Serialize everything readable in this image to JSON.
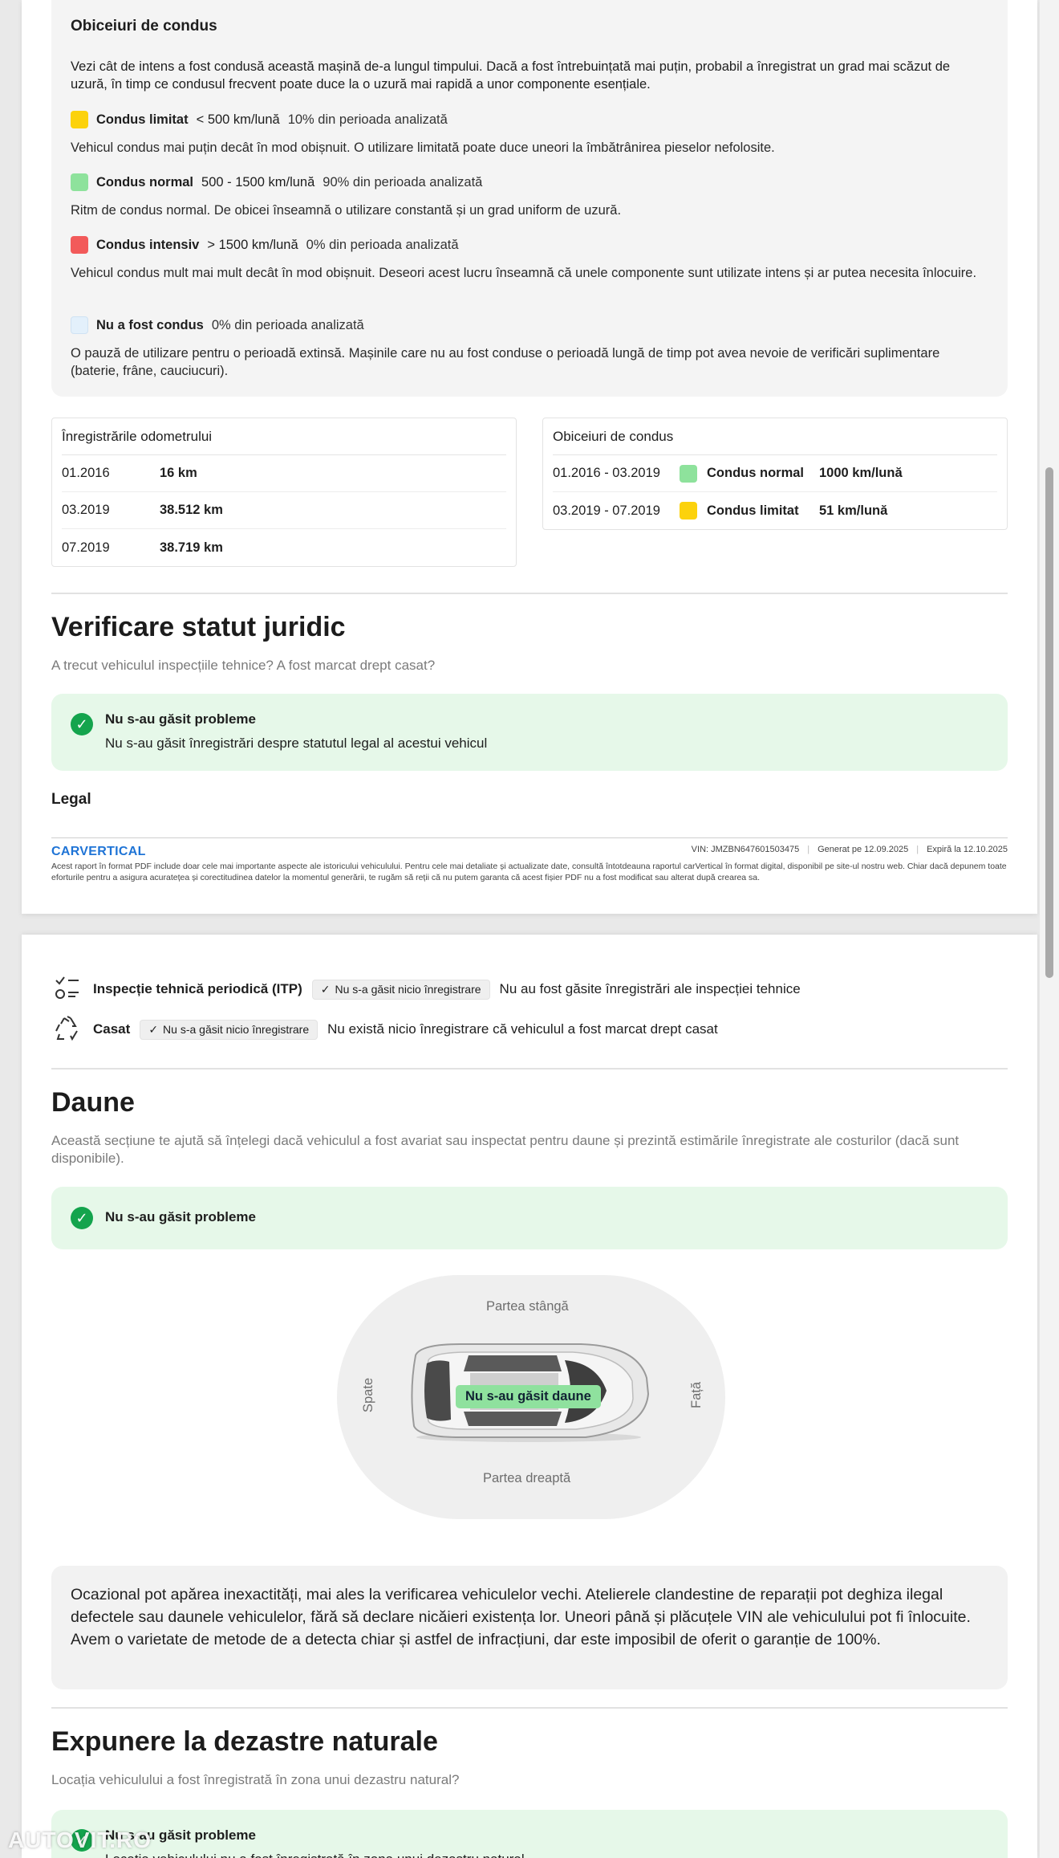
{
  "driving_habits": {
    "title": "Obiceiuri de condus",
    "description": "Vezi cât de intens a fost condusă această mașină de-a lungul timpului. Dacă a fost întrebuințată mai puțin, probabil a înregistrat un grad mai scăzut de uzură, în timp ce condusul frecvent poate duce la o uzură mai rapidă a unor componente esențiale.",
    "items": [
      {
        "name": "Condus limitat",
        "range": "< 500 km/lună",
        "percent": "10% din perioada analizată",
        "text": "Vehicul condus mai puțin decât în mod obișnuit. O utilizare limitată poate duce uneori la îmbătrânirea pieselor nefolosite.",
        "color": "#fcd20c"
      },
      {
        "name": "Condus normal",
        "range": "500 - 1500 km/lună",
        "percent": "90% din perioada analizată",
        "text": "Ritm de condus normal. De obicei înseamnă o utilizare constantă și un grad uniform de uzură.",
        "color": "#8ee29c"
      },
      {
        "name": "Condus intensiv",
        "range": "> 1500 km/lună",
        "percent": "0% din perioada analizată",
        "text": "Vehicul condus mult mai mult decât în mod obișnuit. Deseori acest lucru înseamnă că unele componente sunt utilizate intens și ar putea necesita înlocuire.",
        "color": "#f25a5a"
      },
      {
        "name": "Nu a fost condus",
        "range": "",
        "percent": "0% din perioada analizată",
        "text": "O pauză de utilizare pentru o perioadă extinsă. Mașinile care nu au fost conduse o perioadă lungă de timp pot avea nevoie de verificări suplimentare (baterie, frâne, cauciucuri).",
        "color": "#e3f0fb"
      }
    ]
  },
  "odometer": {
    "title": "Înregistrările odometrului",
    "rows": [
      {
        "date": "01.2016",
        "value": "16 km"
      },
      {
        "date": "03.2019",
        "value": "38.512 km"
      },
      {
        "date": "07.2019",
        "value": "38.719 km"
      }
    ]
  },
  "habits_table": {
    "title": "Obiceiuri de condus",
    "rows": [
      {
        "period": "01.2016 - 03.2019",
        "name": "Condus normal",
        "value": "1000 km/lună",
        "color": "#8ee29c"
      },
      {
        "period": "03.2019 - 07.2019",
        "name": "Condus limitat",
        "value": "51 km/lună",
        "color": "#fcd20c"
      }
    ]
  },
  "legal_status": {
    "title": "Verificare statut juridic",
    "subtitle": "A trecut vehiculul inspecțiile tehnice? A fost marcat drept casat?",
    "ok_title": "Nu s-au găsit probleme",
    "ok_text": "Nu s-au găsit înregistrări despre statutul legal al acestui vehicul",
    "legal_label": "Legal"
  },
  "footer": {
    "logo": "CARVERTICAL",
    "vin": "VIN:  JMZBN647601503475",
    "generated": "Generat pe  12.09.2025",
    "expires": "Expiră la  12.10.2025",
    "disclaimer": "Acest raport în format PDF include doar cele mai importante aspecte ale istoricului vehiculului. Pentru cele mai detaliate și actualizate date, consultă întotdeauna raportul carVertical în format digital, disponibil pe site-ul nostru web. Chiar dacă depunem toate eforturile pentru a asigura acuratețea și corectitudinea datelor la momentul generării, te rugăm să reții că nu putem garanta că acest fișier PDF nu a fost modificat sau alterat după crearea sa."
  },
  "records": [
    {
      "name": "Inspecție tehnică periodică (ITP)",
      "chip": "Nu s-a găsit nicio înregistrare",
      "text": "Nu au fost găsite înregistrări ale inspecției tehnice",
      "icon": "checklist-icon"
    },
    {
      "name": "Casat",
      "chip": "Nu s-a găsit nicio înregistrare",
      "text": "Nu există nicio înregistrare că vehiculul a fost marcat drept casat",
      "icon": "recycle-icon"
    }
  ],
  "damage": {
    "title": "Daune",
    "subtitle": "Această secțiune te ajută să înțelegi dacă vehiculul a fost avariat sau inspectat pentru daune și prezintă estimările înregistrate ale costurilor (dacă sunt disponibile).",
    "ok_title": "Nu s-au găsit probleme",
    "labels": {
      "left": "Partea stângă",
      "right": "Partea dreaptă",
      "rear": "Spate",
      "front": "Față"
    },
    "badge": "Nu s-au găsit daune",
    "note": "Ocazional pot apărea inexactități, mai ales la verificarea vehiculelor vechi. Atelierele clandestine de reparații pot deghiza ilegal defectele sau daunele vehiculelor, fără să declare nicăieri existența lor. Uneori până și plăcuțele VIN ale vehiculului pot fi înlocuite. Avem o varietate de metode de a detecta chiar și astfel de infracțiuni, dar este imposibil de oferit o garanție de 100%."
  },
  "natural_disasters": {
    "title": "Expunere la dezastre naturale",
    "subtitle": "Locația vehiculului a fost înregistrată în zona unui dezastru natural?",
    "ok_title": "Nu s-au găsit probleme",
    "ok_text": "Locația vehiculului nu a fost înregistrată în zona unui dezastru natural"
  },
  "watermark": "AUTOVIT.RO"
}
